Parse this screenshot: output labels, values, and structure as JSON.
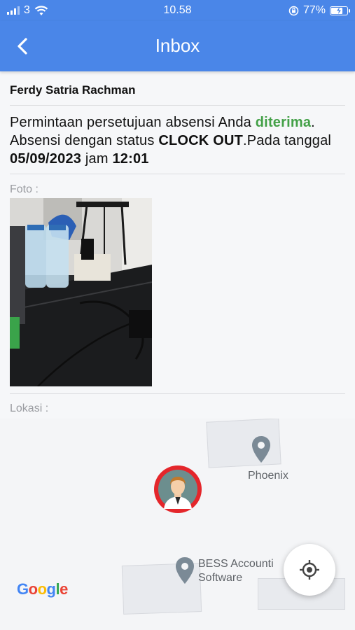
{
  "status_bar": {
    "carrier": "3",
    "time": "10.58",
    "battery_percent": "77%",
    "battery_level": 0.77
  },
  "header": {
    "title": "Inbox",
    "back_icon": "chevron-left-icon"
  },
  "message": {
    "sender": "Ferdy Satria Rachman",
    "part1": "Permintaan persetujuan absensi Anda ",
    "status_word": "diterima",
    "part2": ". Absensi dengan status ",
    "attendance_status": "CLOCK OUT",
    "part3": ".Pada tanggal ",
    "date": "05/09/2023",
    "part4": " jam ",
    "time": "12:01"
  },
  "photo_section": {
    "label": "Foto :"
  },
  "location_section": {
    "label": "Lokasi :"
  },
  "map": {
    "places": [
      {
        "name": "Phoenix"
      },
      {
        "name_line1": "BESS Accounti",
        "name_line2": "Software"
      }
    ],
    "attribution": "Google",
    "locate_icon": "my-location-icon",
    "marker_icon": "user-avatar-marker"
  },
  "colors": {
    "primary": "#4a86e8",
    "accepted": "#43a047",
    "marker_ring": "#e4262b"
  }
}
